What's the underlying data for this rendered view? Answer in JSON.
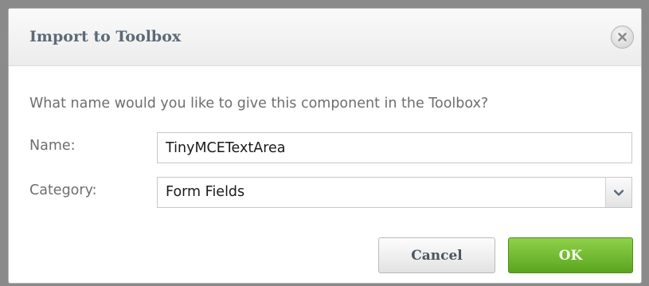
{
  "dialog": {
    "title": "Import to Toolbox",
    "prompt": "What name would you like to give this component in the Toolbox?",
    "close_icon": "close-icon"
  },
  "form": {
    "name_label": "Name:",
    "name_value": "TinyMCETextArea",
    "category_label": "Category:",
    "category_value": "Form Fields"
  },
  "buttons": {
    "cancel_label": "Cancel",
    "ok_label": "OK"
  },
  "colors": {
    "title_text": "#5c6a78",
    "ok_green": "#6fba2c",
    "label_gray": "#6e6e6e"
  }
}
